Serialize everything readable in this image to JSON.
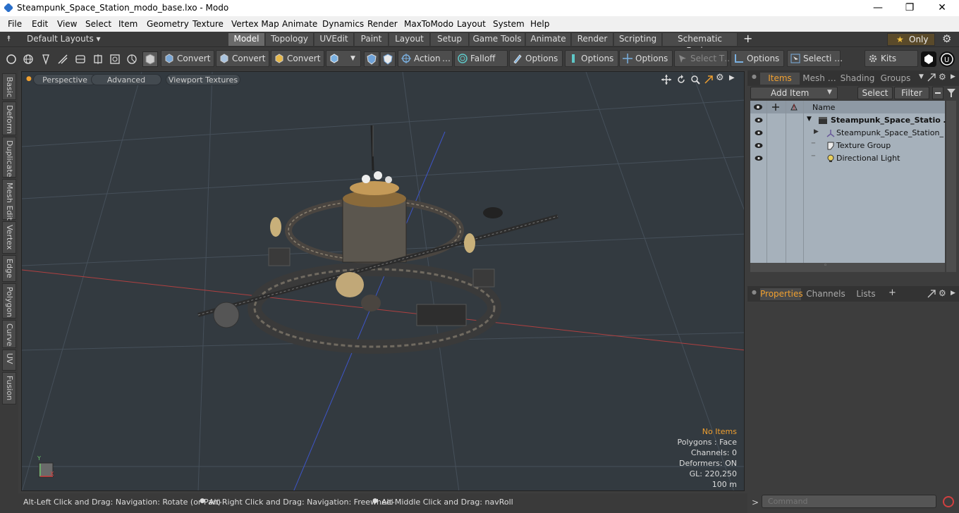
{
  "window": {
    "title": "Steampunk_Space_Station_modo_base.lxo - Modo",
    "minimize": "—",
    "maximize": "❐",
    "close": "✕"
  },
  "menu": [
    "File",
    "Edit",
    "View",
    "Select",
    "Item",
    "Geometry",
    "Texture",
    "Vertex Map",
    "Animate",
    "Dynamics",
    "Render",
    "MaxToModo",
    "Layout",
    "System",
    "Help"
  ],
  "layoutbar": {
    "layouts_label": "Default Layouts ▾",
    "tabs": [
      "Model",
      "Topology",
      "UVEdit",
      "Paint",
      "Layout",
      "Setup",
      "Game Tools",
      "Animate",
      "Render",
      "Scripting",
      "Schematic Fusion"
    ],
    "active_tab": "Model",
    "add": "+",
    "only_label": "Only",
    "star": "★"
  },
  "toolbar": {
    "convert1": "Convert",
    "convert2": "Convert",
    "convert3": "Convert",
    "action": "Action",
    "action_more": "…",
    "falloff": "Falloff",
    "options1": "Options",
    "options2": "Options",
    "options3": "Options",
    "select_t": "Select T…",
    "options4": "Options",
    "selecti": "Selecti …",
    "kits": "Kits"
  },
  "left_tabs": [
    "Basic",
    "Deform",
    "Duplicate",
    "Mesh Edit",
    "Vertex",
    "Edge",
    "Polygon",
    "Curve",
    "UV",
    "Fusion"
  ],
  "viewport": {
    "tabs": [
      "Perspective",
      "Advanced",
      "Viewport Textures"
    ],
    "info": {
      "selection": "No Items",
      "polygons": "Polygons : Face",
      "channels": "Channels: 0",
      "deformers": "Deformers: ON",
      "gl": "GL: 220,250",
      "scale": "100 m"
    },
    "axis_y": "Y",
    "axis_x": "X"
  },
  "status": {
    "hint1": "Alt-Left Click and Drag: Navigation: Rotate (or Pan)",
    "hint2": "Alt-Right Click and Drag: Navigation: Freewheel",
    "hint3": "Alt-Middle Click and Drag: navRoll",
    "bullet": "●"
  },
  "items_panel": {
    "tabs": [
      "Items",
      "Mesh …",
      "Shading",
      "Groups"
    ],
    "add_item": "Add Item",
    "select": "Select",
    "filter": "Filter",
    "name_header": "Name",
    "rows": [
      "Steampunk_Space_Statio …",
      "Steampunk_Space_Station_ …",
      "Texture Group",
      "Directional Light"
    ]
  },
  "properties_panel": {
    "tabs": [
      "Properties",
      "Channels",
      "Lists"
    ],
    "add": "+"
  },
  "command": {
    "label": ">",
    "placeholder": "Command"
  },
  "colors": {
    "accent": "#f0a030",
    "viewport_bg": "#333a40",
    "active_item_tab": "#f0a030"
  }
}
